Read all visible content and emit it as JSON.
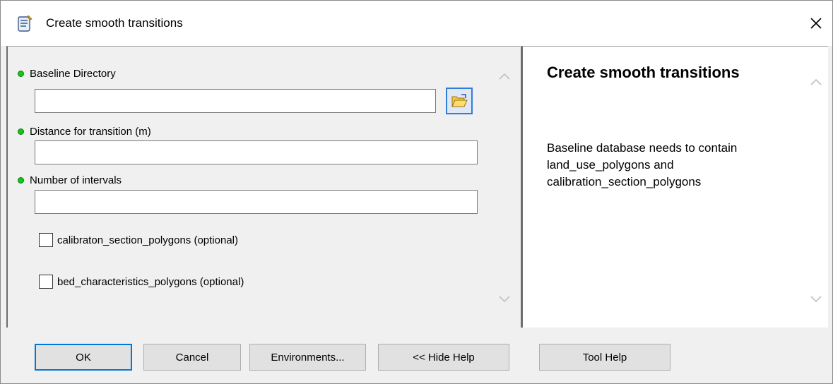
{
  "window": {
    "title": "Create smooth transitions",
    "close_symbol": "✕",
    "icon": "python-script-icon"
  },
  "params": {
    "baseline_directory": {
      "label": "Baseline Directory",
      "value": ""
    },
    "distance": {
      "label": "Distance for transition (m)",
      "value": ""
    },
    "intervals": {
      "label": "Number of intervals",
      "value": ""
    },
    "calibration_polygons": {
      "label": "calibraton_section_polygons (optional)",
      "checked": false
    },
    "bed_polygons": {
      "label": "bed_characteristics_polygons (optional)",
      "checked": false
    }
  },
  "help": {
    "title": "Create smooth transitions",
    "body": "Baseline database needs to contain land_use_polygons and calibration_section_polygons"
  },
  "buttons": {
    "ok": "OK",
    "cancel": "Cancel",
    "environments": "Environments...",
    "hide_help": "<< Hide Help",
    "tool_help": "Tool Help"
  },
  "colors": {
    "required_dot": "#14c814",
    "default_button_border": "#0078d7"
  }
}
